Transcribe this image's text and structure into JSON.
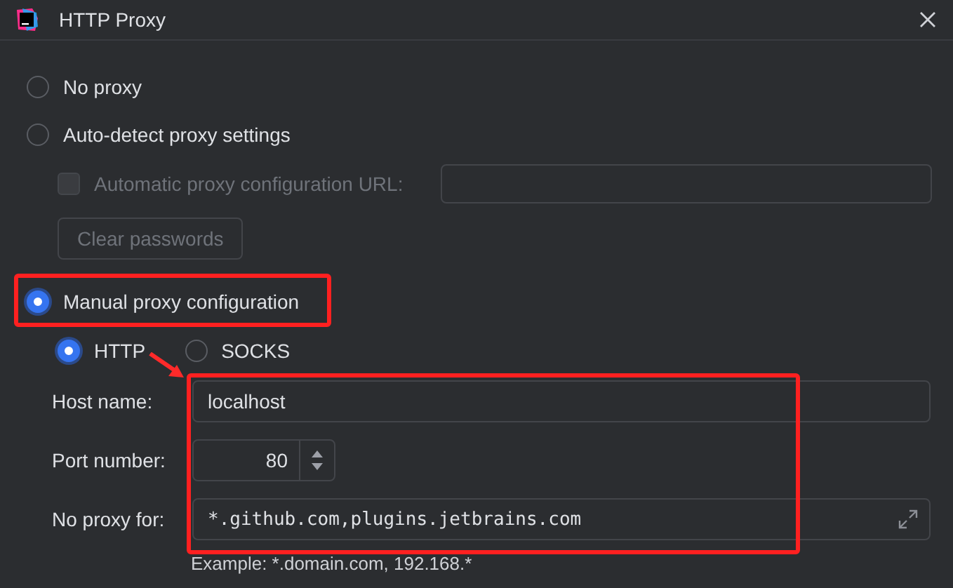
{
  "window": {
    "title": "HTTP Proxy"
  },
  "modes": [
    {
      "label": "No proxy",
      "selected": false
    },
    {
      "label": "Auto-detect proxy settings",
      "selected": false
    },
    {
      "label": "Manual proxy configuration",
      "selected": true
    }
  ],
  "auto_config": {
    "label": "Automatic proxy configuration URL:",
    "checked": false,
    "disabled": true
  },
  "clear_button": {
    "label": "Clear passwords",
    "disabled": true
  },
  "protocols": [
    {
      "label": "HTTP",
      "selected": true
    },
    {
      "label": "SOCKS",
      "selected": false
    }
  ],
  "host": {
    "label": "Host name:",
    "value": "localhost"
  },
  "port": {
    "label": "Port number:",
    "value": "80"
  },
  "no_proxy": {
    "label": "No proxy for:",
    "value": "*.github.com,plugins.jetbrains.com",
    "hint": "Example: *.domain.com, 192.168.*"
  }
}
